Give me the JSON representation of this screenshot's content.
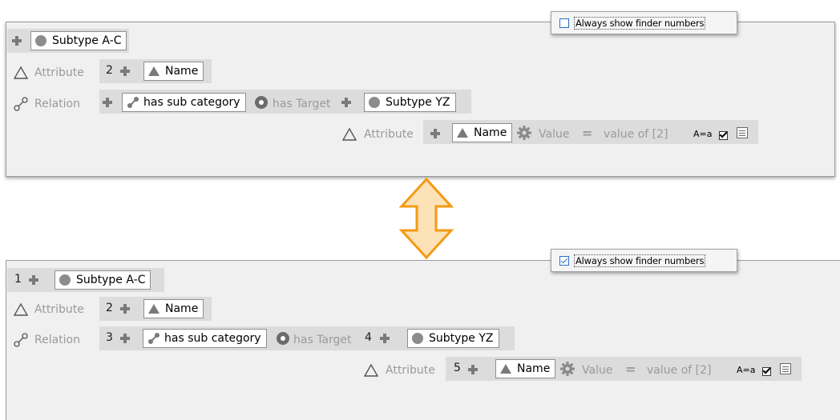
{
  "top_panel": {
    "popup": {
      "checkbox_label": "Always show finder numbers",
      "checked": false
    },
    "root_box": "Subtype A-C",
    "attribute_label": "Attribute",
    "attribute_num": "2",
    "attribute_box": "Name",
    "relation_label": "Relation",
    "relation_box": "has sub category",
    "has_target_label": "has Target",
    "target_box": "Subtype YZ",
    "sub_attribute_label": "Attribute",
    "sub_attribute_box": "Name",
    "value_label": "Value",
    "equals": "=",
    "value_text": "value of [2]",
    "case_label": "A=a"
  },
  "bottom_panel": {
    "popup": {
      "checkbox_label": "Always show finder numbers",
      "checked": true
    },
    "root_num": "1",
    "root_box": "Subtype A-C",
    "attribute_label": "Attribute",
    "attribute_num": "2",
    "attribute_box": "Name",
    "relation_label": "Relation",
    "relation_num": "3",
    "relation_box": "has sub category",
    "has_target_label": "has Target",
    "target_num": "4",
    "target_box": "Subtype YZ",
    "sub_attribute_label": "Attribute",
    "sub_attribute_num": "5",
    "sub_attribute_box": "Name",
    "value_label": "Value",
    "equals": "=",
    "value_text": "value of [2]",
    "case_label": "A=a"
  },
  "colors": {
    "accent": "#2b6fc4",
    "arrow_fill": "#fde2b8",
    "arrow_stroke": "#f59a14"
  }
}
